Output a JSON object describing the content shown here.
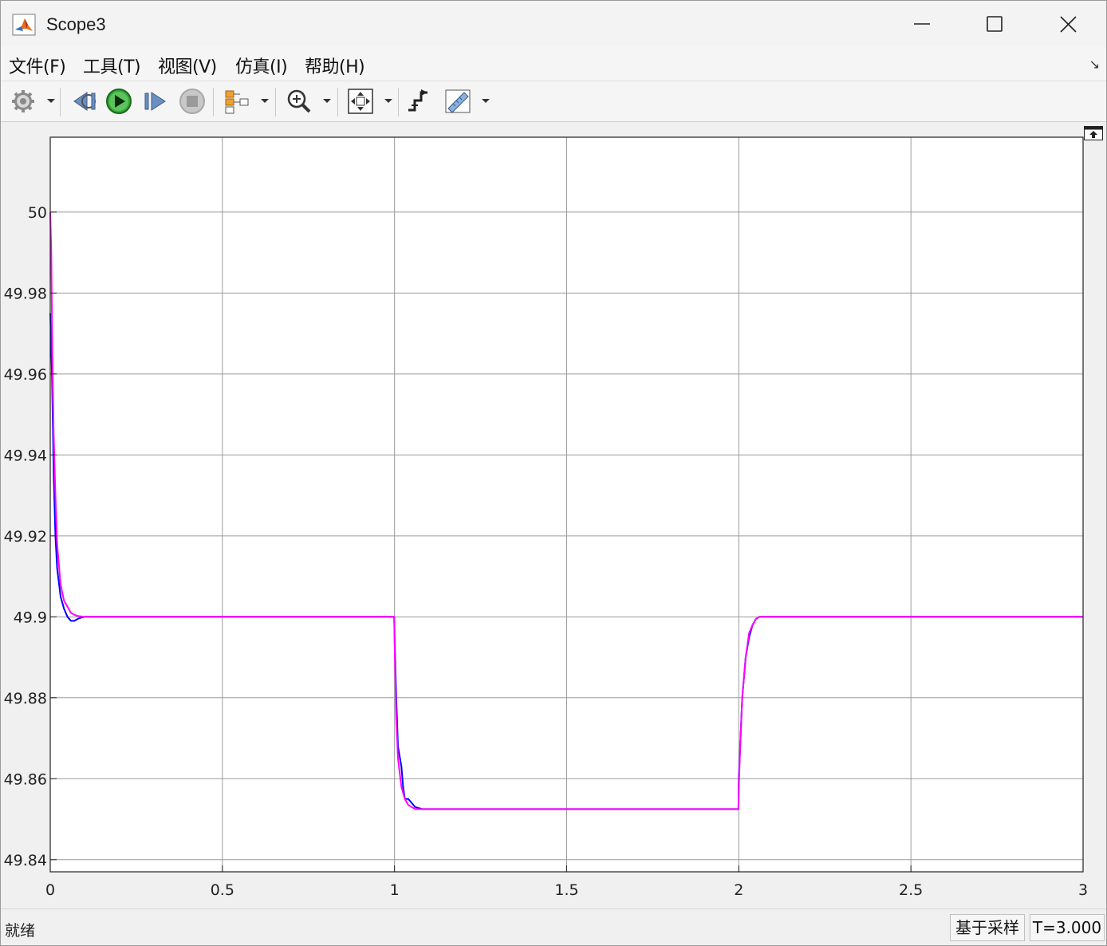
{
  "window": {
    "title": "Scope3",
    "minimize_icon": "minimize-icon",
    "maximize_icon": "maximize-icon",
    "close_icon": "close-icon"
  },
  "menu": {
    "items": [
      {
        "label": "文件(F)"
      },
      {
        "label": "工具(T)"
      },
      {
        "label": "视图(V)"
      },
      {
        "label": "仿真(I)"
      },
      {
        "label": "帮助(H)"
      }
    ],
    "corner_glyph": "↘"
  },
  "toolbar": {
    "buttons": [
      {
        "icon": "settings-gear-icon"
      },
      {
        "icon": "step-back-icon"
      },
      {
        "icon": "run-icon"
      },
      {
        "icon": "step-forward-icon"
      },
      {
        "icon": "stop-icon"
      },
      {
        "icon": "signal-selector-icon"
      },
      {
        "icon": "zoom-in-icon"
      },
      {
        "icon": "fit-to-view-icon"
      },
      {
        "icon": "triggers-icon"
      },
      {
        "icon": "measure-ruler-icon"
      }
    ]
  },
  "colors": {
    "series1": "#0000ff",
    "series2": "#ff00ff",
    "grid": "#9a9a9a",
    "axes_bg": "#ffffff"
  },
  "chart_data": {
    "type": "line",
    "title": "",
    "xlabel": "",
    "ylabel": "",
    "xlim": [
      0,
      3
    ],
    "ylim": [
      49.837,
      50.0185
    ],
    "xticks": [
      0,
      0.5,
      1,
      1.5,
      2,
      2.5,
      3
    ],
    "xtick_labels": [
      "0",
      "0.5",
      "1",
      "1.5",
      "2",
      "2.5",
      "3"
    ],
    "yticks": [
      49.84,
      49.86,
      49.88,
      49.9,
      49.92,
      49.94,
      49.96,
      49.98,
      50
    ],
    "ytick_labels": [
      "49.84",
      "49.86",
      "49.88",
      "49.9",
      "49.92",
      "49.94",
      "49.96",
      "49.98",
      "50"
    ],
    "grid": true,
    "series": [
      {
        "color": "#0000ff",
        "x": [
          0,
          0.005,
          0.01,
          0.015,
          0.02,
          0.03,
          0.04,
          0.05,
          0.06,
          0.07,
          0.08,
          0.09,
          0.1,
          0.2,
          0.4,
          0.6,
          0.8,
          0.999,
          1.0,
          1.005,
          1.01,
          1.02,
          1.025,
          1.03,
          1.04,
          1.05,
          1.06,
          1.08,
          1.2,
          1.5,
          1.8,
          1.999,
          2.0,
          2.01,
          2.02,
          2.03,
          2.04,
          2.05,
          2.06,
          2.08,
          2.2,
          2.5,
          2.8,
          3.0
        ],
        "y": [
          49.975,
          49.96,
          49.935,
          49.92,
          49.912,
          49.905,
          49.902,
          49.9,
          49.899,
          49.899,
          49.8995,
          49.8998,
          49.9,
          49.9,
          49.9,
          49.9,
          49.9,
          49.9,
          49.896,
          49.88,
          49.868,
          49.863,
          49.858,
          49.855,
          49.855,
          49.854,
          49.853,
          49.8525,
          49.8525,
          49.8525,
          49.8525,
          49.8525,
          49.86,
          49.88,
          49.89,
          49.895,
          49.898,
          49.8995,
          49.9,
          49.9,
          49.9,
          49.9,
          49.9,
          49.9
        ]
      },
      {
        "color": "#ff00ff",
        "x": [
          0,
          0.003,
          0.006,
          0.01,
          0.015,
          0.02,
          0.03,
          0.04,
          0.05,
          0.06,
          0.07,
          0.08,
          0.1,
          0.2,
          0.4,
          0.6,
          0.8,
          0.999,
          1.0,
          1.005,
          1.01,
          1.02,
          1.03,
          1.04,
          1.05,
          1.06,
          1.08,
          1.2,
          1.5,
          1.8,
          1.999,
          2.0,
          2.005,
          2.01,
          2.02,
          2.03,
          2.04,
          2.05,
          2.06,
          2.08,
          2.2,
          2.5,
          2.8,
          3.0
        ],
        "y": [
          50.0,
          49.99,
          49.965,
          49.945,
          49.93,
          49.918,
          49.908,
          49.904,
          49.9025,
          49.901,
          49.9005,
          49.9002,
          49.9,
          49.9,
          49.9,
          49.9,
          49.9,
          49.9,
          49.894,
          49.875,
          49.865,
          49.858,
          49.855,
          49.8535,
          49.853,
          49.8525,
          49.8525,
          49.8525,
          49.8525,
          49.8525,
          49.8525,
          49.858,
          49.87,
          49.88,
          49.89,
          49.896,
          49.898,
          49.8995,
          49.9,
          49.9,
          49.9,
          49.9,
          49.9,
          49.9
        ]
      }
    ]
  },
  "status": {
    "left_text": "就绪",
    "sampling_label": "基于采样",
    "time_label": "T=3.000"
  }
}
